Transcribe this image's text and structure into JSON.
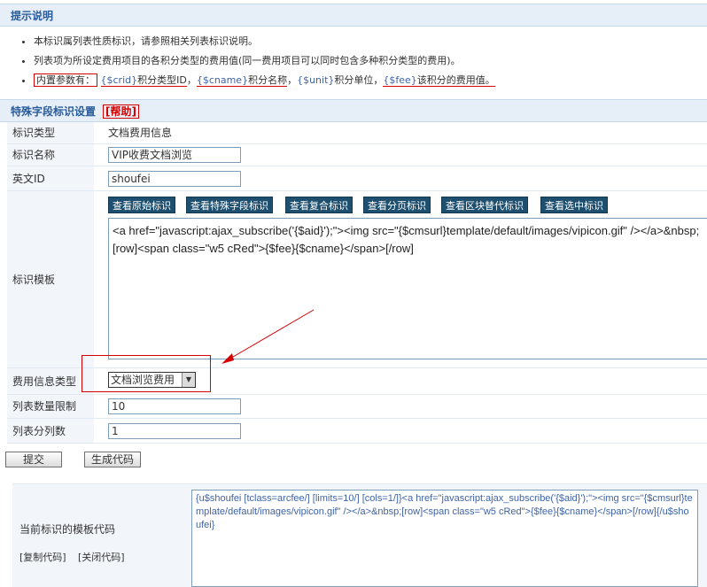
{
  "tips": {
    "title": "提示说明",
    "items": [
      "本标识属列表性质标识，请参照相关列表标识说明。",
      "列表项为所设定费用项目的各积分类型的费用值(同一费用项目可以同时包含多种积分类型的费用)。"
    ],
    "params_label": "内置参数有：",
    "params": [
      {
        "var": "{$crid}",
        "desc": "积分类型ID"
      },
      {
        "var": "{$cname}",
        "desc": "积分名称"
      },
      {
        "var": "{$unit}",
        "desc": "积分单位"
      },
      {
        "var": "{$fee}",
        "desc": "该积分的费用值。"
      }
    ]
  },
  "special": {
    "title": "特殊字段标识设置",
    "help": "[帮助]"
  },
  "form": {
    "type_label": "标识类型",
    "type_value": "文档费用信息",
    "name_label": "标识名称",
    "name_value": "VIP收费文档浏览",
    "en_label": "英文ID",
    "en_value": "shoufei",
    "template_label": "标识模板",
    "template_buttons": [
      "查看原始标识",
      "查看特殊字段标识",
      "查看复合标识",
      "查看分页标识",
      "查看区块替代标识",
      "查看选中标识"
    ],
    "template_value": "<a href=\"javascript:ajax_subscribe('{$aid}');\"><img src=\"{$cmsurl}template/default/images/vipicon.gif\" /></a>&nbsp;[row]<span class=\"w5 cRed\">{$fee}{$cname}</span>[/row]",
    "fee_type_label": "费用信息类型",
    "fee_type_value": "文档浏览费用",
    "limit_label": "列表数量限制",
    "limit_value": "10",
    "cols_label": "列表分列数",
    "cols_value": "1"
  },
  "actions": {
    "submit": "提交",
    "generate": "生成代码"
  },
  "code": {
    "label": "当前标识的模板代码",
    "copy": "[复制代码]",
    "close": "[关闭代码]",
    "value": "{u$shoufei [tclass=arcfee/] [limits=10/] [cols=1/]}<a href=\"javascript:ajax_subscribe('{$aid}');\"><img src=\"{$cmsurl}template/default/images/vipicon.gif\" /></a>&nbsp;[row]<span class=\"w5 cRed\">{$fee}{$cname}</span>[/row]{/u$shoufei}"
  }
}
